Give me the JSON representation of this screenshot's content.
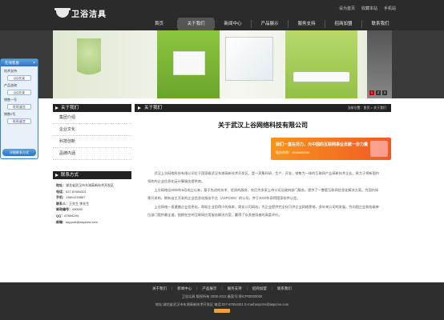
{
  "header": {
    "logo_text": "卫浴洁具",
    "top_links": [
      "设为首页",
      "收藏本站",
      "手机站"
    ],
    "nav": [
      "首页",
      "关于我们",
      "新闻中心",
      "产品展示",
      "服务支持",
      "招商加盟",
      "联系我们"
    ],
    "active_nav": 1
  },
  "banner": {
    "dots": [
      "1",
      "2",
      "3"
    ]
  },
  "sidebar": {
    "about_title": "关于我们",
    "items": [
      "集团介绍",
      "企业文化",
      "科技创新",
      "品牌内涵"
    ],
    "contact_title": "联系方式",
    "contact": [
      {
        "label": "地址：",
        "value": "湖北省武汉市东湖高新技术开发区"
      },
      {
        "label": "电话：",
        "value": "027-87654321"
      },
      {
        "label": "手机：",
        "value": "13601234567"
      },
      {
        "label": "联系人：",
        "value": "王先生 李先生"
      },
      {
        "label": "邮政编号：",
        "value": "430000"
      },
      {
        "label": "QQ：",
        "value": "87654294"
      },
      {
        "label": "邮箱：",
        "value": "support@aspcms.com"
      }
    ]
  },
  "main": {
    "title": "关于我们",
    "breadcrumb": "当前位置：首页 > 关于我们",
    "article_title": "关于武汉上谷网络科技有限公司",
    "promo": {
      "line1": "我们一直在努力，为中国的互联网事业贡献一份力量",
      "line2": "服务热线：4006666936"
    },
    "paragraphs": [
      "武汉上谷网络科技有限公司位于国家级武汉东湖高新技术开发区，是一家集科研、生产、开发、销售为一体的互联网产业高新技术企业。致力于将新国内领先的企业信息化云计算服务提供商。",
      "上谷网络自2008年9月成立以来，基于先进的技术、优质的服务，先后为多家上市公司及政府部门服务，提供了一整套互联网信息化解决方案。为国内如果开发的，拥有自主开发的企业信息化服务平台（ASPCMS）的公司，并于2010年获得国家软件认定。",
      "上谷网络一直遵循企业信息化，帮助企业用得少的成本，简化公司网站，为企业提供完全化可供企业网络营销，多年来公司的发展。为向国企业和各级单位部门提供最全道，指期在空的互联网应用服务解决方案，赢得了众多使用者的高度评价。"
    ]
  },
  "qq_service": {
    "title": "在线客服",
    "groups": [
      {
        "label": "技术支持",
        "button": "QQ交谈"
      },
      {
        "label": "产品咨询",
        "button": "QQ交谈"
      },
      {
        "label": "销售一号",
        "button": "旺旺留言"
      },
      {
        "label": "销售2号",
        "button": "旺旺留言"
      }
    ],
    "footer": "详细联系方式"
  },
  "footer": {
    "links": [
      "关于我们",
      "新闻中心",
      "产品展示",
      "服务支持",
      "招商加盟",
      "联系我们"
    ],
    "line1": "卫浴洁具 版权所有 2008-2012   备案号:鄂ICP00000000",
    "line2": "地址:湖北省武汉市东湖高新技术开发区   电话:027-87654321 E-mail:aspcms@aspcms.com"
  }
}
